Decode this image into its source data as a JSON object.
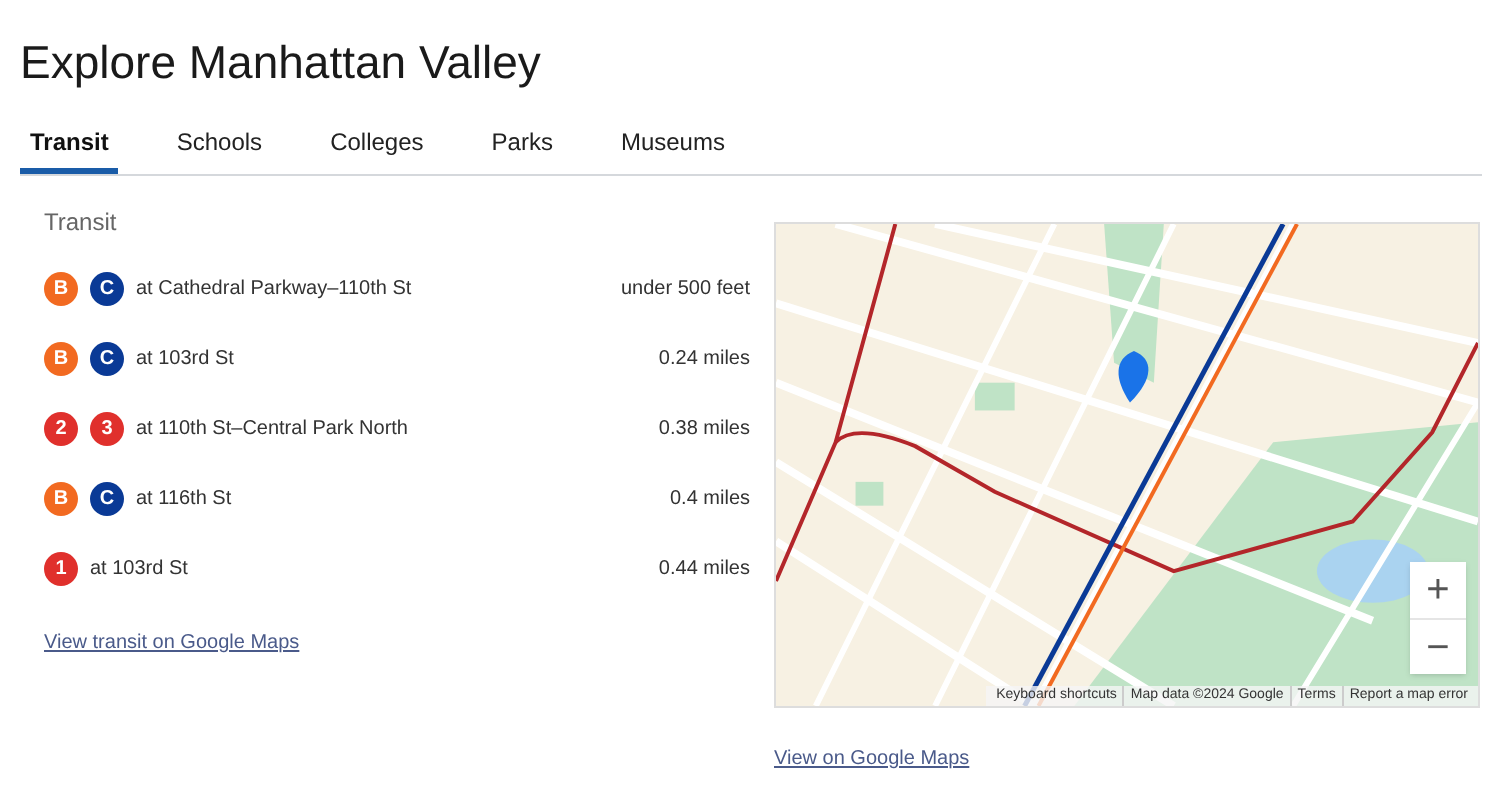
{
  "title": "Explore Manhattan Valley",
  "tabs": [
    {
      "label": "Transit",
      "selected": true
    },
    {
      "label": "Schools",
      "selected": false
    },
    {
      "label": "Colleges",
      "selected": false
    },
    {
      "label": "Parks",
      "selected": false
    },
    {
      "label": "Museums",
      "selected": false
    }
  ],
  "section_heading": "Transit",
  "stations": [
    {
      "lines": [
        {
          "label": "B",
          "color": "#f26a21"
        },
        {
          "label": "C",
          "color": "#0a3a96"
        }
      ],
      "name": "at Cathedral Parkway–110th St",
      "distance": "under 500 feet"
    },
    {
      "lines": [
        {
          "label": "B",
          "color": "#f26a21"
        },
        {
          "label": "C",
          "color": "#0a3a96"
        }
      ],
      "name": "at 103rd St",
      "distance": "0.24 miles"
    },
    {
      "lines": [
        {
          "label": "2",
          "color": "#e0302c"
        },
        {
          "label": "3",
          "color": "#e0302c"
        }
      ],
      "name": "at 110th St–Central Park North",
      "distance": "0.38 miles"
    },
    {
      "lines": [
        {
          "label": "B",
          "color": "#f26a21"
        },
        {
          "label": "C",
          "color": "#0a3a96"
        }
      ],
      "name": "at 116th St",
      "distance": "0.4 miles"
    },
    {
      "lines": [
        {
          "label": "1",
          "color": "#e0302c"
        }
      ],
      "name": "at 103rd St",
      "distance": "0.44 miles"
    }
  ],
  "transit_link": "View transit on Google Maps",
  "map": {
    "zoom_in": "+",
    "zoom_out": "−",
    "footer": [
      "Keyboard shortcuts",
      "Map data ©2024 Google",
      "Terms",
      "Report a map error"
    ]
  },
  "map_link": "View on Google Maps"
}
